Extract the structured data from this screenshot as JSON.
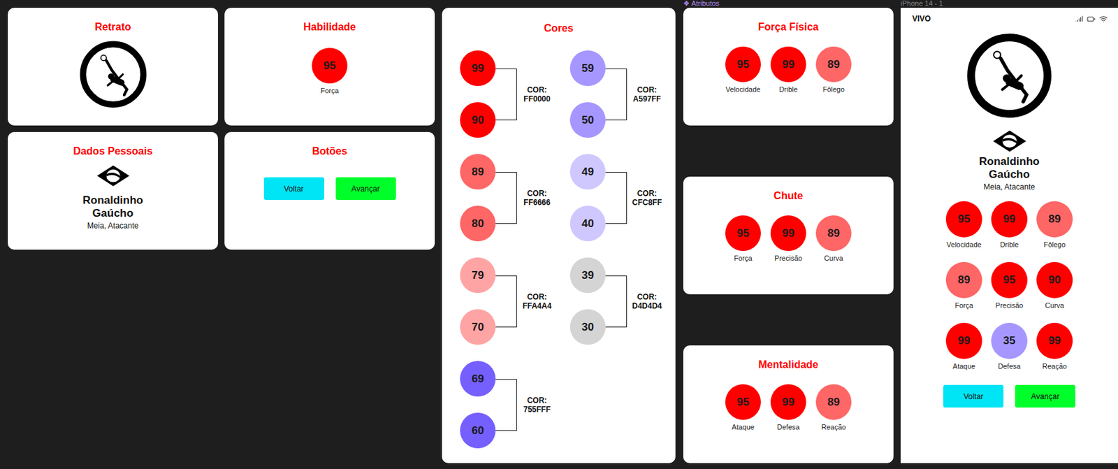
{
  "canvas": {
    "portrait_card": {
      "title": "Retrato"
    },
    "skill_card": {
      "title": "Habilidade",
      "stat": {
        "value": "95",
        "label": "Força",
        "color": "#FF0000"
      }
    },
    "personal_card": {
      "title": "Dados Pessoais",
      "name": "Ronaldinho Gaúcho",
      "positions": "Meia, Atacante"
    },
    "buttons_card": {
      "title": "Botões",
      "buttons": [
        {
          "label": "Voltar",
          "color": "#00E5F5"
        },
        {
          "label": "Avançar",
          "color": "#00FF2A"
        }
      ]
    },
    "colors_card": {
      "title": "Cores",
      "columns": [
        [
          {
            "label": "COR:",
            "code": "FF0000",
            "color": "#FF0000",
            "values": [
              "99",
              "90"
            ]
          },
          {
            "label": "COR:",
            "code": "FF6666",
            "color": "#FF6666",
            "values": [
              "89",
              "80"
            ]
          },
          {
            "label": "COR:",
            "code": "FFA4A4",
            "color": "#FFA4A4",
            "values": [
              "79",
              "70"
            ]
          },
          {
            "label": "COR:",
            "code": "755FFF",
            "color": "#755FFF",
            "values": [
              "69",
              "60"
            ]
          }
        ],
        [
          {
            "label": "COR:",
            "code": "A597FF",
            "color": "#A597FF",
            "values": [
              "59",
              "50"
            ]
          },
          {
            "label": "COR:",
            "code": "CFC8FF",
            "color": "#CFC8FF",
            "values": [
              "49",
              "40"
            ]
          },
          {
            "label": "COR:",
            "code": "D4D4D4",
            "color": "#D4D4D4",
            "values": [
              "39",
              "30"
            ]
          }
        ]
      ]
    },
    "attributes": {
      "icon": "❖",
      "label": "Atributos",
      "cards": [
        {
          "title": "Força Física",
          "stats": [
            {
              "value": "95",
              "label": "Velocidade",
              "color": "#FF0000"
            },
            {
              "value": "99",
              "label": "Drible",
              "color": "#FF0000"
            },
            {
              "value": "89",
              "label": "Fôlego",
              "color": "#FF6666"
            }
          ]
        },
        {
          "title": "Chute",
          "stats": [
            {
              "value": "95",
              "label": "Força",
              "color": "#FF0000"
            },
            {
              "value": "99",
              "label": "Precisão",
              "color": "#FF0000"
            },
            {
              "value": "89",
              "label": "Curva",
              "color": "#FF6666"
            }
          ]
        },
        {
          "title": "Mentalidade",
          "stats": [
            {
              "value": "95",
              "label": "Ataque",
              "color": "#FF0000"
            },
            {
              "value": "99",
              "label": "Defesa",
              "color": "#FF0000"
            },
            {
              "value": "89",
              "label": "Reação",
              "color": "#FF6666"
            }
          ]
        }
      ]
    },
    "phone": {
      "label": "iPhone 14 - 1",
      "carrier": "VIVO",
      "name": "Ronaldinho Gaúcho",
      "positions": "Meia, Atacante",
      "stats": [
        {
          "value": "95",
          "label": "Velocidade",
          "color": "#FF0000"
        },
        {
          "value": "99",
          "label": "Drible",
          "color": "#FF0000"
        },
        {
          "value": "89",
          "label": "Fôlego",
          "color": "#FF6666"
        },
        {
          "value": "89",
          "label": "Força",
          "color": "#FF6666"
        },
        {
          "value": "95",
          "label": "Precisão",
          "color": "#FF0000"
        },
        {
          "value": "90",
          "label": "Curva",
          "color": "#FF0000"
        },
        {
          "value": "99",
          "label": "Ataque",
          "color": "#FF0000"
        },
        {
          "value": "35",
          "label": "Defesa",
          "color": "#A597FF"
        },
        {
          "value": "99",
          "label": "Reação",
          "color": "#FF0000"
        }
      ],
      "buttons": [
        {
          "label": "Voltar",
          "color": "#00E5F5"
        },
        {
          "label": "Avançar",
          "color": "#00FF2A"
        }
      ]
    }
  }
}
